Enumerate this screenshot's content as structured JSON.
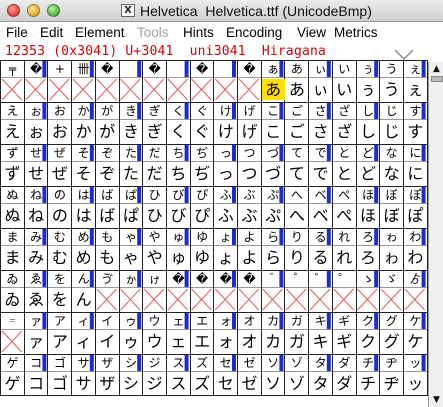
{
  "window": {
    "title": "Helvetica  Helvetica.ttf (UnicodeBmp)",
    "app_icon": "X"
  },
  "menus": [
    "File",
    "Edit",
    "Element",
    "Tools",
    "Hints",
    "Encoding",
    "View",
    "Metrics"
  ],
  "info_line": "12353 (0x3041) U+3041  uni3041  Hiragana",
  "glyph_rows": [
    {
      "labels": [
        "╤",
        "�",
        "+",
        "卌",
        "�",
        "",
        "�",
        "",
        "�",
        "",
        "�",
        "ぁ",
        "あ",
        "ぃ",
        "い",
        "ぅ",
        "う",
        "ぇ"
      ],
      "glyphs": [
        "",
        "",
        "",
        "",
        "",
        "",
        "",
        "",
        "",
        "",
        "",
        "あ",
        "あ",
        "ぃ",
        "い",
        "ぅ",
        "う",
        "ぇ"
      ]
    },
    {
      "labels": [
        "え",
        "ぉ",
        "お",
        "か",
        "が",
        "き",
        "ぎ",
        "く",
        "ぐ",
        "け",
        "げ",
        "こ",
        "ご",
        "さ",
        "ざ",
        "し",
        "じ",
        "す"
      ],
      "glyphs": [
        "え",
        "ぉ",
        "お",
        "か",
        "が",
        "き",
        "ぎ",
        "く",
        "ぐ",
        "け",
        "げ",
        "こ",
        "ご",
        "さ",
        "ざ",
        "し",
        "じ",
        "す"
      ]
    },
    {
      "labels": [
        "ず",
        "せ",
        "ぜ",
        "そ",
        "ぞ",
        "た",
        "だ",
        "ち",
        "ぢ",
        "っ",
        "つ",
        "づ",
        "て",
        "で",
        "と",
        "ど",
        "な",
        "に"
      ],
      "glyphs": [
        "ず",
        "せ",
        "ぜ",
        "そ",
        "ぞ",
        "た",
        "だ",
        "ち",
        "ぢ",
        "っ",
        "つ",
        "づ",
        "て",
        "で",
        "と",
        "ど",
        "な",
        "に"
      ]
    },
    {
      "labels": [
        "ぬ",
        "ね",
        "の",
        "は",
        "ば",
        "ぱ",
        "ひ",
        "び",
        "ぴ",
        "ふ",
        "ぶ",
        "ぷ",
        "へ",
        "べ",
        "ぺ",
        "ほ",
        "ぼ",
        "ぽ"
      ],
      "glyphs": [
        "ぬ",
        "ね",
        "の",
        "は",
        "ば",
        "ぱ",
        "ひ",
        "び",
        "ぴ",
        "ふ",
        "ぶ",
        "ぷ",
        "へ",
        "べ",
        "ぺ",
        "ほ",
        "ぼ",
        "ぽ"
      ]
    },
    {
      "labels": [
        "ま",
        "み",
        "む",
        "め",
        "も",
        "ゃ",
        "や",
        "ゅ",
        "ゆ",
        "ょ",
        "よ",
        "ら",
        "り",
        "る",
        "れ",
        "ろ",
        "ゎ",
        "わ"
      ],
      "glyphs": [
        "ま",
        "み",
        "む",
        "め",
        "も",
        "ゃ",
        "や",
        "ゅ",
        "ゆ",
        "ょ",
        "よ",
        "ら",
        "り",
        "る",
        "れ",
        "ろ",
        "ゎ",
        "わ"
      ]
    },
    {
      "labels": [
        "ゐ",
        "ゑ",
        "を",
        "ん",
        "ゔ",
        "ゕ",
        "ゖ",
        "�",
        "�",
        "�",
        "�",
        "゙",
        "゚",
        "゛",
        "゜",
        "ゝ",
        "ゞ",
        "ゟ"
      ],
      "glyphs": [
        "ゐ",
        "ゑ",
        "を",
        "ん",
        "",
        "",
        "",
        "",
        "",
        "",
        "",
        "",
        "",
        "",
        "",
        "",
        "",
        ""
      ]
    },
    {
      "labels": [
        "゠",
        "ァ",
        "ア",
        "ィ",
        "イ",
        "ゥ",
        "ウ",
        "ェ",
        "エ",
        "ォ",
        "オ",
        "カ",
        "ガ",
        "キ",
        "ギ",
        "ク",
        "グ",
        "ケ"
      ],
      "glyphs": [
        "",
        "ァ",
        "ア",
        "ィ",
        "イ",
        "ゥ",
        "ウ",
        "ェ",
        "エ",
        "ォ",
        "オ",
        "カ",
        "ガ",
        "キ",
        "ギ",
        "ク",
        "グ",
        "ケ"
      ]
    },
    {
      "labels": [
        "ゲ",
        "コ",
        "ゴ",
        "サ",
        "ザ",
        "シ",
        "ジ",
        "ス",
        "ズ",
        "セ",
        "ゼ",
        "ソ",
        "ゾ",
        "タ",
        "ダ",
        "チ",
        "ヂ",
        "ッ"
      ],
      "glyphs": [
        "ゲ",
        "コ",
        "ゴ",
        "サ",
        "ザ",
        "シ",
        "ジ",
        "ス",
        "ズ",
        "セ",
        "ゼ",
        "ソ",
        "ゾ",
        "タ",
        "ダ",
        "チ",
        "ヂ",
        "ッ"
      ]
    }
  ],
  "colors": {
    "bar_blue": "#1a2bd8",
    "selected": "#ffe000",
    "info_red": "#d80000",
    "cross_red": "#e35b5b"
  }
}
